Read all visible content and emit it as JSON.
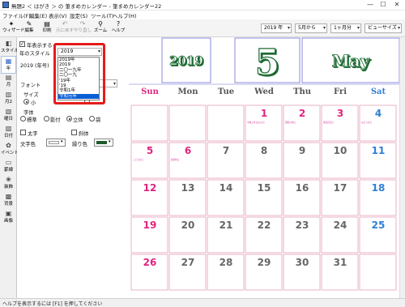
{
  "window": {
    "title": "無題2 ＜ はがき ＞ の 筆まめカレンダー - 筆まめカレンダー22",
    "minimize": "—",
    "maximize": "☐",
    "close": "✕"
  },
  "menu": [
    "ファイル(F)",
    "編集(E)",
    "表示(V)",
    "設定(S)",
    "ツール(T)",
    "ヘルプ(H)"
  ],
  "toolbar": {
    "buttons": [
      {
        "label": "ウィザード",
        "icon": "wizard-icon",
        "glyph": "✦",
        "enabled": true
      },
      {
        "label": "編集",
        "icon": "edit-icon",
        "glyph": "✎",
        "enabled": true
      },
      {
        "label": "印刷",
        "icon": "print-icon",
        "glyph": "▤",
        "enabled": true
      },
      {
        "label": "元に戻す",
        "icon": "undo-icon",
        "glyph": "↶",
        "enabled": false
      },
      {
        "label": "やり直し",
        "icon": "redo-icon",
        "glyph": "↷",
        "enabled": false
      },
      {
        "label": "ズーム",
        "icon": "zoom-icon",
        "glyph": "⚲",
        "enabled": true
      },
      {
        "label": "ヘルプ",
        "icon": "help-icon",
        "glyph": "?",
        "enabled": true
      }
    ],
    "year_select": "2019 年",
    "month_select": "5月から",
    "period_select": "1ヶ月分",
    "view_select": "ビューサイズ"
  },
  "sidetabs": [
    {
      "label": "スタイル",
      "icon": "style-icon",
      "glyph": "◧",
      "active": false
    },
    {
      "label": "年",
      "icon": "year-icon",
      "glyph": "▦",
      "active": true
    },
    {
      "label": "月",
      "icon": "month-icon",
      "glyph": "▤",
      "active": false
    },
    {
      "label": "月2",
      "icon": "month2-icon",
      "glyph": "▥",
      "active": false
    },
    {
      "label": "曜日",
      "icon": "weekday-icon",
      "glyph": "▧",
      "active": false
    },
    {
      "label": "日付",
      "icon": "date-icon",
      "glyph": "▨",
      "active": false
    },
    {
      "label": "イベント",
      "icon": "event-icon",
      "glyph": "✿",
      "active": false
    },
    {
      "label": "罫線",
      "icon": "ruledline-icon",
      "glyph": "▭",
      "active": false
    },
    {
      "label": "装飾",
      "icon": "decoration-icon",
      "glyph": "❀",
      "active": false
    },
    {
      "label": "背景",
      "icon": "background-icon",
      "glyph": "▩",
      "active": false
    },
    {
      "label": "画像",
      "icon": "image-icon",
      "glyph": "▣",
      "active": false
    }
  ],
  "panel": {
    "show_year_label": "年表示する",
    "show_year_checked": "✓",
    "year_style_label": "年のスタイル",
    "year_style_value": "2019",
    "preview_text": "2019 (年号)",
    "font_label": "フォント",
    "size_label": "サイズ",
    "size_small": "小",
    "style_label": "字体",
    "style_options": [
      "標準",
      "影付",
      "立体",
      "袋"
    ],
    "style_selected": 2,
    "bold_label": "太字",
    "italic_label": "斜体",
    "text_color_label": "文字色",
    "edge_color_label": "縁り色",
    "edge_color": "#1e5b2a",
    "dropdown_options": [
      "2019年",
      "2019",
      "二〇一九年",
      "二〇一九",
      "'19年",
      "'19",
      "令和1年",
      "令和元年"
    ],
    "dropdown_highlighted": 7
  },
  "calendar": {
    "year": "2019",
    "month_number": "5",
    "month_name": "May",
    "weekdays": [
      "Sun",
      "Mon",
      "Tue",
      "Wed",
      "Thu",
      "Fri",
      "Sat"
    ],
    "weekday_colors": [
      "#e0247e",
      "#555555",
      "#555555",
      "#555555",
      "#555555",
      "#555555",
      "#2f7fd6"
    ],
    "weeks": [
      [
        {
          "d": "",
          "c": "n"
        },
        {
          "d": "",
          "c": "n"
        },
        {
          "d": "",
          "c": "n"
        },
        {
          "d": "1",
          "c": "h",
          "note": "令和元年 改元の日"
        },
        {
          "d": "2",
          "c": "h",
          "note": "国民の休日"
        },
        {
          "d": "3",
          "c": "h",
          "note": "憲法記念日"
        },
        {
          "d": "4",
          "c": "s",
          "note": "みどりの日"
        }
      ],
      [
        {
          "d": "5",
          "c": "h",
          "note": "こどもの日"
        },
        {
          "d": "6",
          "c": "h",
          "note": "振替休日"
        },
        {
          "d": "7",
          "c": "n"
        },
        {
          "d": "8",
          "c": "n"
        },
        {
          "d": "9",
          "c": "n"
        },
        {
          "d": "10",
          "c": "n"
        },
        {
          "d": "11",
          "c": "s"
        }
      ],
      [
        {
          "d": "12",
          "c": "h",
          "note": ""
        },
        {
          "d": "13",
          "c": "n"
        },
        {
          "d": "14",
          "c": "n"
        },
        {
          "d": "15",
          "c": "n"
        },
        {
          "d": "16",
          "c": "n"
        },
        {
          "d": "17",
          "c": "n"
        },
        {
          "d": "18",
          "c": "s"
        }
      ],
      [
        {
          "d": "19",
          "c": "h"
        },
        {
          "d": "20",
          "c": "n"
        },
        {
          "d": "21",
          "c": "n"
        },
        {
          "d": "22",
          "c": "n"
        },
        {
          "d": "23",
          "c": "n"
        },
        {
          "d": "24",
          "c": "n"
        },
        {
          "d": "25",
          "c": "s"
        }
      ],
      [
        {
          "d": "26",
          "c": "h"
        },
        {
          "d": "27",
          "c": "n"
        },
        {
          "d": "28",
          "c": "n"
        },
        {
          "d": "29",
          "c": "n"
        },
        {
          "d": "30",
          "c": "n"
        },
        {
          "d": "31",
          "c": "n"
        },
        {
          "d": "",
          "c": "n"
        }
      ]
    ],
    "colors": {
      "h": "#e0247e",
      "s": "#2f7fd6",
      "n": "#666666",
      "grid": "#e6a0ba",
      "header_green": "#1e6b33"
    }
  },
  "status": "ヘルプを表示するには [F1] を押してください"
}
